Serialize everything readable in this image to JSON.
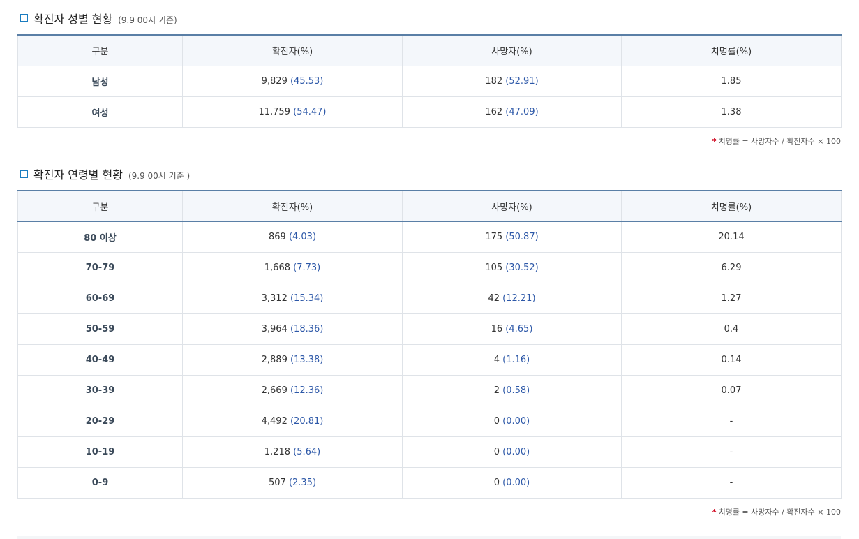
{
  "gender": {
    "title": "확진자 성별 현황",
    "subtitle": "(9.9 00시 기준)",
    "headers": [
      "구분",
      "확진자(%)",
      "사망자(%)",
      "치명률(%)"
    ],
    "rows": [
      {
        "category": "남성",
        "confirmed": "9,829",
        "confirmed_pct": "(45.53)",
        "deaths": "182",
        "deaths_pct": "(52.91)",
        "fatality": "1.85"
      },
      {
        "category": "여성",
        "confirmed": "11,759",
        "confirmed_pct": "(54.47)",
        "deaths": "162",
        "deaths_pct": "(47.09)",
        "fatality": "1.38"
      }
    ],
    "note_star": "*",
    "note": "치명률 = 사망자수 / 확진자수 × 100"
  },
  "age": {
    "title": "확진자 연령별 현황",
    "subtitle": "(9.9 00시 기준 )",
    "headers": [
      "구분",
      "확진자(%)",
      "사망자(%)",
      "치명률(%)"
    ],
    "rows": [
      {
        "category": "80 이상",
        "confirmed": "869",
        "confirmed_pct": "(4.03)",
        "deaths": "175",
        "deaths_pct": "(50.87)",
        "fatality": "20.14"
      },
      {
        "category": "70-79",
        "confirmed": "1,668",
        "confirmed_pct": "(7.73)",
        "deaths": "105",
        "deaths_pct": "(30.52)",
        "fatality": "6.29"
      },
      {
        "category": "60-69",
        "confirmed": "3,312",
        "confirmed_pct": "(15.34)",
        "deaths": "42",
        "deaths_pct": "(12.21)",
        "fatality": "1.27"
      },
      {
        "category": "50-59",
        "confirmed": "3,964",
        "confirmed_pct": "(18.36)",
        "deaths": "16",
        "deaths_pct": "(4.65)",
        "fatality": "0.4"
      },
      {
        "category": "40-49",
        "confirmed": "2,889",
        "confirmed_pct": "(13.38)",
        "deaths": "4",
        "deaths_pct": "(1.16)",
        "fatality": "0.14"
      },
      {
        "category": "30-39",
        "confirmed": "2,669",
        "confirmed_pct": "(12.36)",
        "deaths": "2",
        "deaths_pct": "(0.58)",
        "fatality": "0.07"
      },
      {
        "category": "20-29",
        "confirmed": "4,492",
        "confirmed_pct": "(20.81)",
        "deaths": "0",
        "deaths_pct": "(0.00)",
        "fatality": "-"
      },
      {
        "category": "10-19",
        "confirmed": "1,218",
        "confirmed_pct": "(5.64)",
        "deaths": "0",
        "deaths_pct": "(0.00)",
        "fatality": "-"
      },
      {
        "category": "0-9",
        "confirmed": "507",
        "confirmed_pct": "(2.35)",
        "deaths": "0",
        "deaths_pct": "(0.00)",
        "fatality": "-"
      }
    ],
    "note_star": "*",
    "note": "치명률 = 사망자수 / 확진자수 × 100"
  },
  "colors": {
    "accent": "#1a7cc0",
    "header_bg": "#f4f7fb",
    "header_border": "#5a7fa6",
    "value_blue": "#2d58a8",
    "note_star": "#d0021b"
  },
  "icons": {
    "section_bullet": "square-bullet-icon"
  }
}
